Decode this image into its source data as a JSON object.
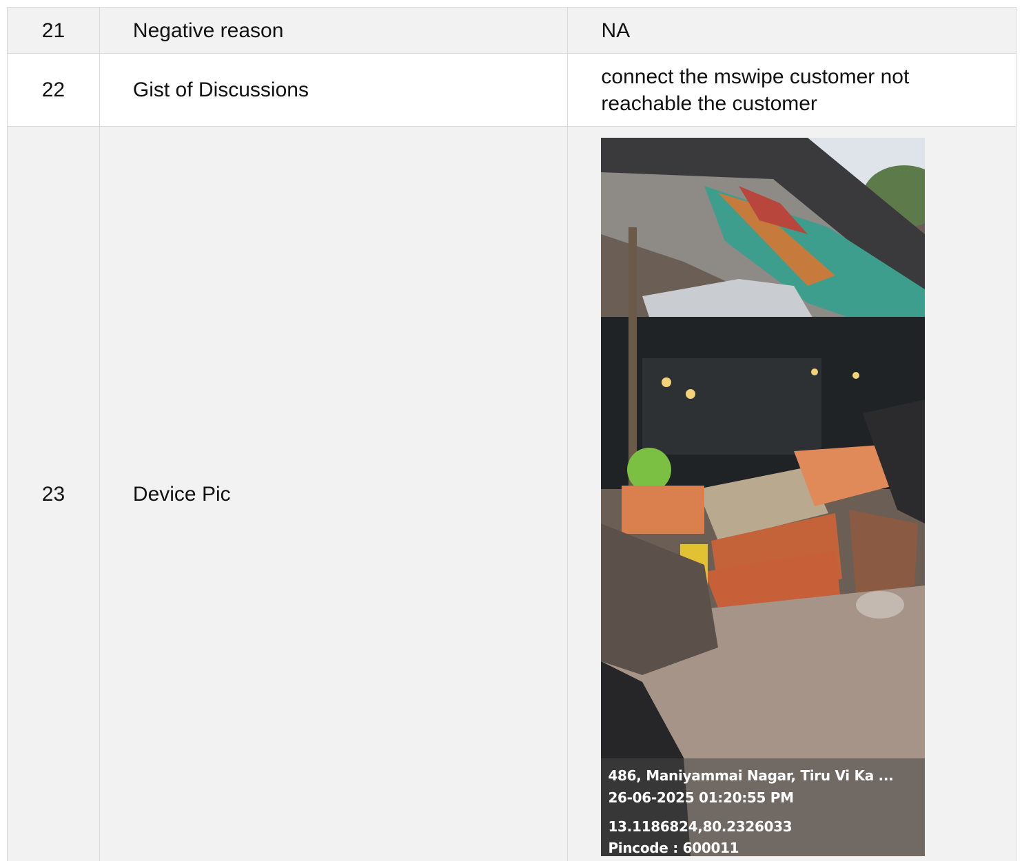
{
  "rows": [
    {
      "num": "21",
      "label": "Negative reason",
      "value": "NA"
    },
    {
      "num": "22",
      "label": "Gist of Discussions",
      "value": "connect the mswipe customer not reachable the customer"
    },
    {
      "num": "23",
      "label": "Device Pic"
    }
  ],
  "photo": {
    "address": "486, Maniyammai Nagar, Tiru Vi Ka ...",
    "datetime": "26-06-2025 01:20:55 PM",
    "coords": "13.1186824,80.2326033",
    "pincode": "Pincode : 600011"
  }
}
